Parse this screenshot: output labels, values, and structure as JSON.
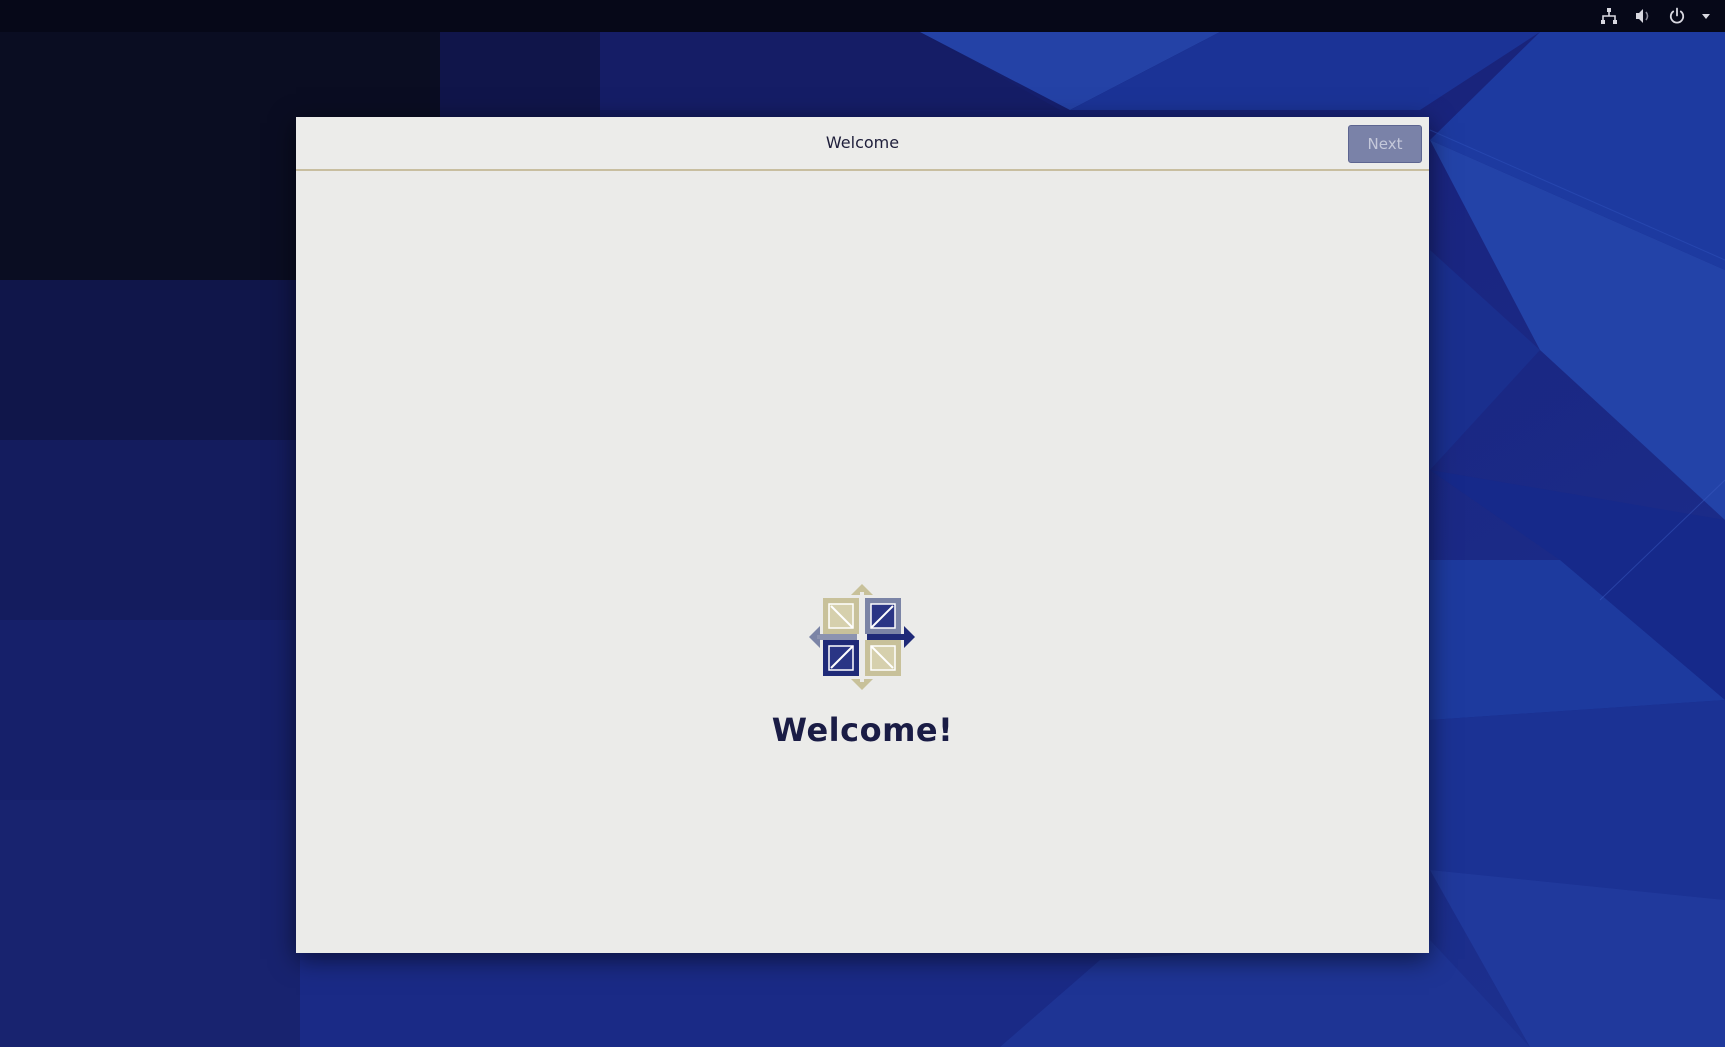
{
  "window": {
    "title": "Welcome",
    "next_label": "Next"
  },
  "content": {
    "heading": "Welcome!"
  },
  "tray": {
    "icons": [
      "network-icon",
      "volume-icon",
      "power-icon",
      "chevron-down-icon"
    ]
  },
  "colors": {
    "wallpaper_base": "#1a2580",
    "topbar": "#060818",
    "window_bg": "#ebebe9",
    "header_border": "#c8bea0",
    "next_button_bg": "#7a82a8",
    "heading_text": "#1a1c45",
    "logo_tan": "#c8c19a",
    "logo_navy": "#1f2a78",
    "logo_slate": "#7b84a6"
  }
}
